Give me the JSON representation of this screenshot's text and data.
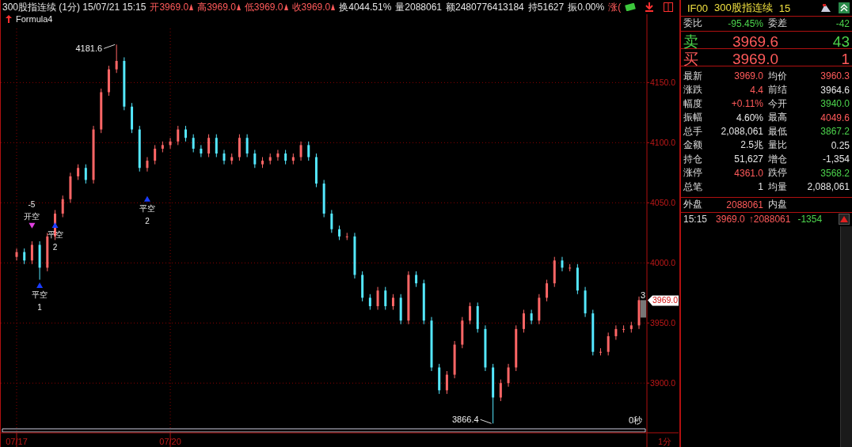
{
  "header": {
    "title": "300股指连续 (1分) 15/07/21 15:15",
    "quotes": [
      {
        "label": "开",
        "value": "3969.0",
        "color": "#ff5a5a",
        "flag": true
      },
      {
        "label": "高",
        "value": "3969.0",
        "color": "#ff5a5a",
        "flag": true
      },
      {
        "label": "低",
        "value": "3969.0",
        "color": "#ff5a5a",
        "flag": true
      },
      {
        "label": "收",
        "value": "3969.0",
        "color": "#ff5a5a",
        "flag": true
      },
      {
        "label": "换",
        "value": "4044.51%",
        "color": "#e6e6e6",
        "flag": false
      },
      {
        "label": "量",
        "value": "2088061",
        "color": "#e6e6e6",
        "flag": false
      },
      {
        "label": "额",
        "value": "2480776413184",
        "color": "#e6e6e6",
        "flag": false
      },
      {
        "label": "持",
        "value": "51627",
        "color": "#e6e6e6",
        "flag": false
      },
      {
        "label": "振",
        "value": "0.00%",
        "color": "#e6e6e6",
        "flag": false
      },
      {
        "label": "涨(",
        "color": "#ff5a5a",
        "flag": false
      }
    ]
  },
  "chart": {
    "formula": "Formula4",
    "price_tag": "3969.0",
    "bar_count": "3",
    "countdown": "0秒",
    "period": "1分",
    "chart_data": {
      "type": "candlestick",
      "ylim": [
        3860,
        4195
      ],
      "grid": true,
      "yticks": [
        {
          "value": 3900,
          "label": "3900.0"
        },
        {
          "value": 3950,
          "label": "3950.0"
        },
        {
          "value": 4000,
          "label": "4000.0"
        },
        {
          "value": 4050,
          "label": "4050.0"
        },
        {
          "value": 4100,
          "label": "4100.0"
        },
        {
          "value": 4150,
          "label": "4150.0"
        }
      ],
      "categories": [
        "07/17",
        null,
        null,
        null,
        null,
        null,
        null,
        null,
        null,
        null,
        null,
        null,
        null,
        null,
        null,
        null,
        null,
        null,
        null,
        null,
        "07/20",
        null,
        null,
        null,
        null,
        null,
        null,
        null,
        null,
        null,
        null,
        null,
        null,
        null,
        null,
        null,
        null,
        null,
        null,
        null,
        null,
        null,
        null,
        null,
        null,
        null,
        null,
        null,
        null,
        null,
        null,
        null,
        null,
        null,
        null,
        null,
        null,
        null,
        null,
        null,
        null,
        null,
        null,
        null,
        null,
        null,
        null,
        null,
        null,
        null,
        null,
        null,
        null,
        null,
        null,
        null,
        null,
        null,
        null,
        null,
        null,
        null
      ],
      "ohlc": [
        [
          4005,
          4012,
          4002,
          4009
        ],
        [
          4009,
          4012,
          3999,
          4002
        ],
        [
          4002,
          4018,
          3999,
          4015
        ],
        [
          4015,
          4018,
          3986,
          3996
        ],
        [
          3996,
          4025,
          3993,
          4022
        ],
        [
          4022,
          4044,
          4019,
          4041
        ],
        [
          4041,
          4056,
          4038,
          4053
        ],
        [
          4053,
          4075,
          4050,
          4072
        ],
        [
          4072,
          4082,
          4069,
          4079
        ],
        [
          4079,
          4082,
          4066,
          4069
        ],
        [
          4069,
          4114,
          4066,
          4111
        ],
        [
          4111,
          4145,
          4108,
          4142
        ],
        [
          4142,
          4164,
          4139,
          4161
        ],
        [
          4161,
          4181.6,
          4158,
          4168
        ],
        [
          4168,
          4171,
          4127,
          4130
        ],
        [
          4130,
          4133,
          4108,
          4111
        ],
        [
          4111,
          4114,
          4076,
          4079
        ],
        [
          4079,
          4088,
          4076,
          4085
        ],
        [
          4085,
          4098,
          4082,
          4095
        ],
        [
          4095,
          4101,
          4092,
          4098
        ],
        [
          4098,
          4104,
          4095,
          4101
        ],
        [
          4101,
          4114,
          4098,
          4111
        ],
        [
          4111,
          4114,
          4101,
          4104
        ],
        [
          4104,
          4107,
          4092,
          4095
        ],
        [
          4095,
          4098,
          4088,
          4091
        ],
        [
          4091,
          4107,
          4088,
          4104
        ],
        [
          4104,
          4107,
          4088,
          4091
        ],
        [
          4091,
          4094,
          4082,
          4085
        ],
        [
          4085,
          4091,
          4082,
          4088
        ],
        [
          4088,
          4107,
          4085,
          4104
        ],
        [
          4104,
          4107,
          4088,
          4091
        ],
        [
          4091,
          4094,
          4079,
          4082
        ],
        [
          4082,
          4088,
          4079,
          4085
        ],
        [
          4085,
          4091,
          4082,
          4088
        ],
        [
          4088,
          4094,
          4085,
          4091
        ],
        [
          4091,
          4094,
          4082,
          4085
        ],
        [
          4085,
          4091,
          4082,
          4088
        ],
        [
          4088,
          4101,
          4085,
          4098
        ],
        [
          4098,
          4101,
          4085,
          4088
        ],
        [
          4088,
          4091,
          4063,
          4066
        ],
        [
          4066,
          4069,
          4038,
          4041
        ],
        [
          4041,
          4044,
          4025,
          4028
        ],
        [
          4028,
          4031,
          4019,
          4022
        ],
        [
          4022,
          4025,
          4019,
          4022
        ],
        [
          4022,
          4025,
          3987,
          3990
        ],
        [
          3990,
          3993,
          3968,
          3971
        ],
        [
          3971,
          3974,
          3961,
          3964
        ],
        [
          3964,
          3980,
          3961,
          3977
        ],
        [
          3977,
          3980,
          3961,
          3964
        ],
        [
          3964,
          3974,
          3961,
          3971
        ],
        [
          3971,
          3974,
          3949,
          3952
        ],
        [
          3952,
          3993,
          3949,
          3990
        ],
        [
          3990,
          3993,
          3980,
          3983
        ],
        [
          3983,
          3986,
          3949,
          3952
        ],
        [
          3952,
          3955,
          3910,
          3913
        ],
        [
          3913,
          3916,
          3891,
          3894
        ],
        [
          3894,
          3910,
          3891,
          3907
        ],
        [
          3907,
          3935,
          3904,
          3932
        ],
        [
          3932,
          3955,
          3929,
          3952
        ],
        [
          3952,
          3967,
          3949,
          3964
        ],
        [
          3964,
          3967,
          3942,
          3945
        ],
        [
          3945,
          3948,
          3910,
          3913
        ],
        [
          3913,
          3916,
          3866.4,
          3888
        ],
        [
          3888,
          3903,
          3885,
          3900
        ],
        [
          3900,
          3916,
          3897,
          3913
        ],
        [
          3913,
          3948,
          3910,
          3945
        ],
        [
          3945,
          3961,
          3942,
          3958
        ],
        [
          3958,
          3961,
          3949,
          3952
        ],
        [
          3952,
          3974,
          3949,
          3971
        ],
        [
          3971,
          3986,
          3968,
          3983
        ],
        [
          3983,
          4005,
          3980,
          4002
        ],
        [
          4002,
          4005,
          3993,
          3996
        ],
        [
          3996,
          3999,
          3993,
          3996
        ],
        [
          3996,
          3999,
          3974,
          3977
        ],
        [
          3977,
          3980,
          3955,
          3958
        ],
        [
          3958,
          3961,
          3923,
          3926
        ],
        [
          3926,
          3929,
          3923,
          3926
        ],
        [
          3926,
          3942,
          3923,
          3939
        ],
        [
          3939,
          3948,
          3936,
          3945
        ],
        [
          3945,
          3948,
          3942,
          3945
        ],
        [
          3945,
          3951,
          3942,
          3948
        ],
        [
          3948,
          3972,
          3945,
          3969
        ]
      ],
      "annotations": [
        "4181.6",
        "3866.4"
      ]
    },
    "signals": [
      {
        "kind": "open",
        "label": "开空",
        "count": "-5"
      },
      {
        "kind": "close",
        "label": "平空",
        "count": "1"
      },
      {
        "kind": "close",
        "label": "平空",
        "count": "2"
      },
      {
        "kind": "close",
        "label": "平空",
        "count": "2"
      }
    ]
  },
  "panel": {
    "code": "IF00",
    "name": "300股指连续",
    "period": "15",
    "ratio": [
      {
        "label": "委比",
        "value": "-95.45%",
        "color": "#4cd44c"
      },
      {
        "label": "委差",
        "value": "-42",
        "color": "#4cd44c"
      }
    ],
    "book": [
      {
        "side": {
          "text": "卖",
          "color": "#4cd44c"
        },
        "price": {
          "text": "3969.6",
          "color": "#ff5a5a"
        },
        "volume": {
          "text": "43",
          "color": "#4cd44c"
        }
      },
      {
        "side": {
          "text": "买",
          "color": "#ff5a5a"
        },
        "price": {
          "text": "3969.0",
          "color": "#ff5a5a"
        },
        "volume": {
          "text": "1",
          "color": "#ff5a5a"
        }
      }
    ],
    "stats": [
      {
        "label": "最新",
        "value": "3969.0",
        "color": "#ff5a5a"
      },
      {
        "label": "均价",
        "value": "3960.3",
        "color": "#ff5a5a"
      },
      {
        "label": "涨跌",
        "value": "4.4",
        "color": "#ff5a5a"
      },
      {
        "label": "前结",
        "value": "3964.6",
        "color": "#e6e6e6"
      },
      {
        "label": "幅度",
        "value": "+0.11%",
        "color": "#ff5a5a"
      },
      {
        "label": "今开",
        "value": "3940.0",
        "color": "#4cd44c"
      },
      {
        "label": "振幅",
        "value": "4.60%",
        "color": "#e6e6e6"
      },
      {
        "label": "最高",
        "value": "4049.6",
        "color": "#ff5a5a"
      },
      {
        "label": "总手",
        "value": "2,088,061",
        "color": "#e6e6e6"
      },
      {
        "label": "最低",
        "value": "3867.2",
        "color": "#4cd44c"
      },
      {
        "label": "金额",
        "value": "2.5兆",
        "color": "#e6e6e6"
      },
      {
        "label": "量比",
        "value": "0.25",
        "color": "#e6e6e6"
      },
      {
        "label": "持仓",
        "value": "51,627",
        "color": "#e6e6e6"
      },
      {
        "label": "增仓",
        "value": "-1,354",
        "color": "#e6e6e6"
      },
      {
        "label": "涨停",
        "value": "4361.0",
        "color": "#ff5a5a"
      },
      {
        "label": "跌停",
        "value": "3568.2",
        "color": "#4cd44c"
      },
      {
        "label": "总笔",
        "value": "1",
        "color": "#e6e6e6"
      },
      {
        "label": "均量",
        "value": "2,088,061",
        "color": "#e6e6e6"
      }
    ],
    "outer": [
      {
        "label": "外盘",
        "value": "2088061",
        "color": "#ff5a5a"
      },
      {
        "label": "内盘"
      }
    ],
    "ticks": [
      {
        "time": "15:15",
        "price": {
          "text": "3969.0",
          "color": "#ff5a5a"
        },
        "volume": {
          "text": "↑2088061",
          "color": "#ff5a5a"
        },
        "change": {
          "text": "-1354",
          "color": "#4cd44c"
        }
      }
    ]
  }
}
